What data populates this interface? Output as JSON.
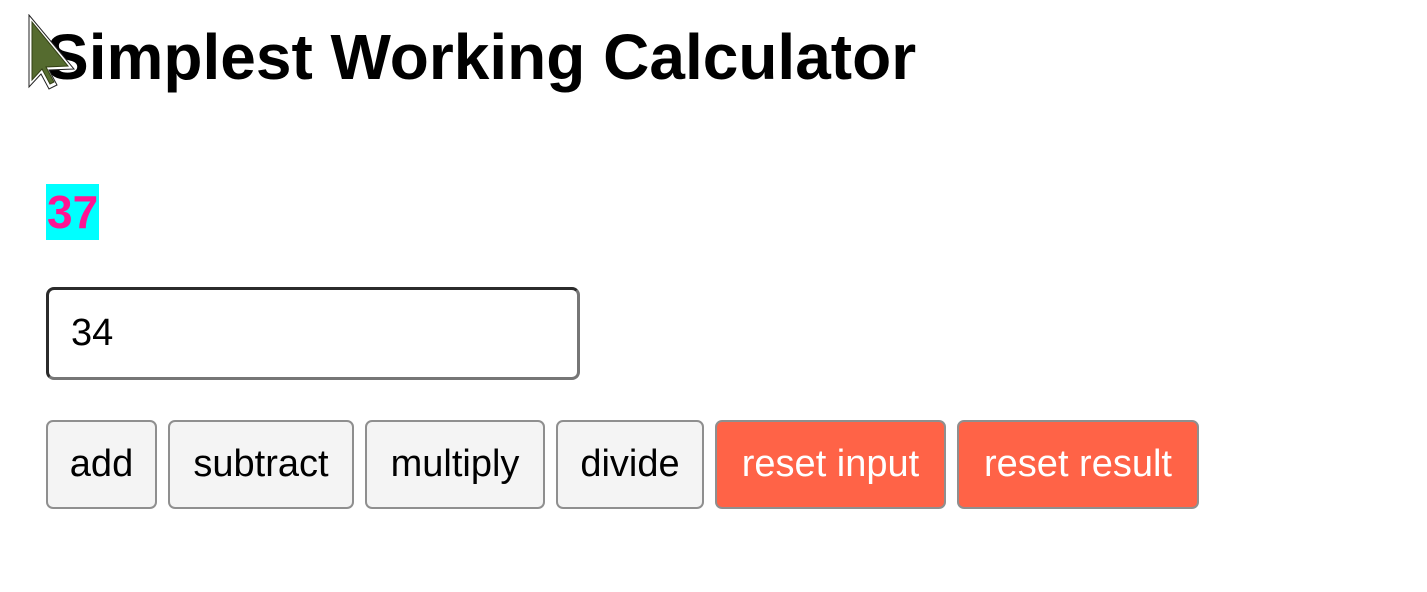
{
  "page": {
    "title": "Simplest Working Calculator"
  },
  "result": {
    "value": "37"
  },
  "input": {
    "value": "34"
  },
  "buttons": {
    "add": "add",
    "subtract": "subtract",
    "multiply": "multiply",
    "divide": "divide",
    "reset_input": "reset input",
    "reset_result": "reset result"
  },
  "colors": {
    "result_background": "#00ffff",
    "result_text": "#ff1493",
    "reset_button_background": "#ff6347",
    "cursor_fill": "#556b2f"
  },
  "cursor": {
    "icon": "mouse-pointer-icon"
  }
}
